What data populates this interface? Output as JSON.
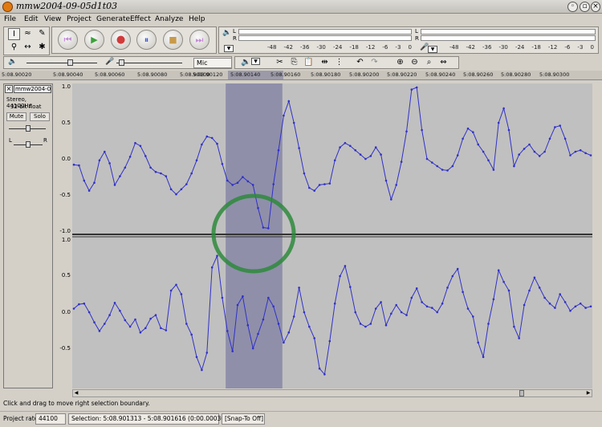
{
  "window": {
    "title": "mmw2004-09-05d1t03"
  },
  "menu": {
    "items": [
      "File",
      "Edit",
      "View",
      "Project",
      "Generate",
      "Effect",
      "Analyze",
      "Help"
    ]
  },
  "meter": {
    "play_channels": [
      "L",
      "R"
    ],
    "rec_channels": [
      "L",
      "R"
    ],
    "scale": [
      "-48",
      "-42",
      "-36",
      "-30",
      "-24",
      "-18",
      "-12",
      "-6",
      "-3",
      "0"
    ]
  },
  "mixer": {
    "input_source": "Mic"
  },
  "ruler": {
    "ticks": [
      "5:08.90020",
      "5:08.90040",
      "5:08.90060",
      "5:08.90080",
      "5:08.90100",
      "5:08.90120",
      "5:08.90140",
      "5:08.90160",
      "5:08.90180",
      "5:08.90200",
      "5:08.90220",
      "5:08.90240",
      "5:08.90260",
      "5:08.90280",
      "5:08.90300"
    ]
  },
  "track": {
    "name": "mmw2004-0",
    "info_line1": "Stereo, 44100Hz",
    "info_line2": "32-bit float",
    "mute_label": "Mute",
    "solo_label": "Solo",
    "pan_left": "L",
    "pan_right": "R",
    "y_labels": [
      "1.0",
      "0.5",
      "0.0",
      "-0.5",
      "-1.0"
    ]
  },
  "waveform": {
    "left_channel": [
      -0.08,
      -0.09,
      -0.3,
      -0.44,
      -0.33,
      -0.02,
      0.1,
      -0.06,
      -0.36,
      -0.24,
      -0.12,
      0.03,
      0.22,
      0.18,
      0.04,
      -0.12,
      -0.18,
      -0.2,
      -0.24,
      -0.42,
      -0.49,
      -0.42,
      -0.35,
      -0.2,
      -0.02,
      0.2,
      0.31,
      0.29,
      0.21,
      -0.07,
      -0.3,
      -0.36,
      -0.33,
      -0.25,
      -0.31,
      -0.36,
      -0.68,
      -0.95,
      -0.96,
      -0.35,
      0.12,
      0.6,
      0.8,
      0.5,
      0.15,
      -0.2,
      -0.4,
      -0.44,
      -0.36,
      -0.35,
      -0.34,
      -0.02,
      0.16,
      0.22,
      0.18,
      0.12,
      0.06,
      0.0,
      0.04,
      0.16,
      0.06,
      -0.3,
      -0.56,
      -0.36,
      -0.04,
      0.38,
      0.96,
      0.99,
      0.4,
      0.0,
      -0.05,
      -0.1,
      -0.15,
      -0.16,
      -0.1,
      0.05,
      0.28,
      0.42,
      0.37,
      0.2,
      0.1,
      -0.02,
      -0.15,
      0.5,
      0.7,
      0.4,
      -0.1,
      0.06,
      0.14,
      0.2,
      0.1,
      0.04,
      0.1,
      0.28,
      0.44,
      0.46,
      0.28,
      0.05,
      0.1,
      0.12,
      0.08,
      0.05
    ],
    "right_channel": [
      0.05,
      0.11,
      0.12,
      0.0,
      -0.14,
      -0.26,
      -0.16,
      -0.04,
      0.13,
      0.02,
      -0.11,
      -0.2,
      -0.1,
      -0.28,
      -0.22,
      -0.09,
      -0.04,
      -0.22,
      -0.25,
      0.3,
      0.38,
      0.25,
      -0.16,
      -0.31,
      -0.62,
      -0.8,
      -0.56,
      0.62,
      0.78,
      0.2,
      -0.26,
      -0.54,
      0.1,
      0.22,
      -0.18,
      -0.5,
      -0.3,
      -0.1,
      0.2,
      0.08,
      -0.16,
      -0.42,
      -0.28,
      -0.06,
      0.34,
      0.0,
      -0.2,
      -0.36,
      -0.78,
      -0.86,
      -0.4,
      0.12,
      0.5,
      0.64,
      0.35,
      0.0,
      -0.16,
      -0.2,
      -0.16,
      0.05,
      0.14,
      -0.18,
      -0.02,
      0.1,
      0.0,
      -0.04,
      0.2,
      0.33,
      0.14,
      0.08,
      0.06,
      0.0,
      0.12,
      0.34,
      0.5,
      0.6,
      0.28,
      0.05,
      -0.06,
      -0.42,
      -0.62,
      -0.16,
      0.18,
      0.58,
      0.42,
      0.3,
      -0.2,
      -0.36,
      0.1,
      0.3,
      0.48,
      0.34,
      0.2,
      0.12,
      0.06,
      0.25,
      0.14,
      0.02,
      0.08,
      0.12,
      0.06,
      0.08
    ]
  },
  "selection": {
    "start_fraction": 0.295,
    "end_fraction": 0.404
  },
  "status": {
    "hint": "Click and drag to move right selection boundary.",
    "project_rate_label": "Project rate:",
    "project_rate_value": "44100",
    "selection_text": "Selection: 5:08.901313 - 5:08.901616 (0:00.000303 min:sec)",
    "snap_text": "[Snap-To Off]"
  }
}
